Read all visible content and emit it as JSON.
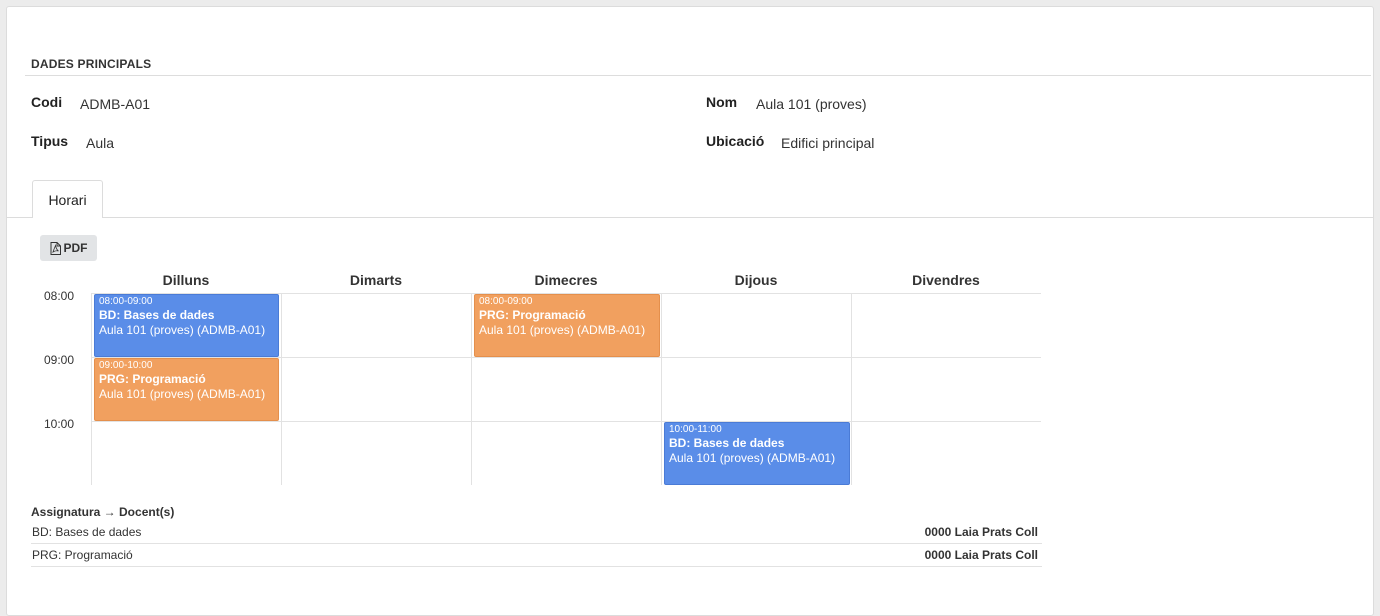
{
  "main": {
    "section_title": "DADES PRINCIPALS",
    "fields": {
      "codi": {
        "label": "Codi",
        "value": "ADMB-A01"
      },
      "nom": {
        "label": "Nom",
        "value": "Aula 101 (proves)"
      },
      "tipus": {
        "label": "Tipus",
        "value": "Aula"
      },
      "ubicacio": {
        "label": "Ubicació",
        "value": "Edifici principal"
      }
    }
  },
  "tabs": [
    {
      "label": "Horari",
      "active": true
    }
  ],
  "toolbar": {
    "pdf_label": "PDF",
    "pdf_icon": "pdf-file-icon"
  },
  "schedule": {
    "days": [
      "Dilluns",
      "Dimarts",
      "Dimecres",
      "Dijous",
      "Divendres"
    ],
    "times": [
      "08:00",
      "09:00",
      "10:00"
    ],
    "events": [
      {
        "day": "Dilluns",
        "time": "08:00-09:00",
        "title": "BD: Bases de dades",
        "room": "Aula 101 (proves) (ADMB-A01)",
        "color": "#5a8de8"
      },
      {
        "day": "Dilluns",
        "time": "09:00-10:00",
        "title": "PRG: Programació",
        "room": "Aula 101 (proves) (ADMB-A01)",
        "color": "#f1a05f"
      },
      {
        "day": "Dimecres",
        "time": "08:00-09:00",
        "title": "PRG: Programació",
        "room": "Aula 101 (proves) (ADMB-A01)",
        "color": "#f1a05f"
      },
      {
        "day": "Dijous",
        "time": "10:00-11:00",
        "title": "BD: Bases de dades",
        "room": "Aula 101 (proves) (ADMB-A01)",
        "color": "#5a8de8"
      }
    ]
  },
  "legend": {
    "header": "Assignatura → Docent(s)",
    "rows": [
      {
        "subject": "BD: Bases de dades",
        "teacher": "0000 Laia Prats Coll"
      },
      {
        "subject": "PRG: Programació",
        "teacher": "0000 Laia Prats Coll"
      }
    ]
  },
  "colors": {
    "blue_event": "#5a8de8",
    "orange_event": "#f1a05f"
  }
}
